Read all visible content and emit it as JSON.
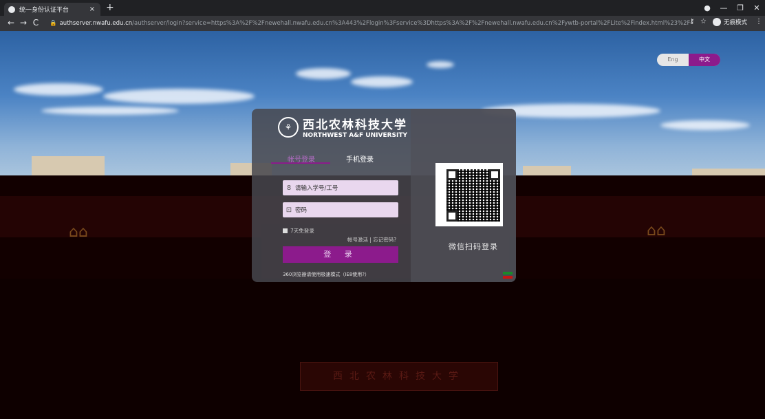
{
  "browser": {
    "tab_title": "统一身份认证平台",
    "tab_close": "×",
    "new_tab": "+",
    "url_host": "authserver.nwafu.edu.cn",
    "url_path": "/authserver/login?service=https%3A%2F%2Fnewehall.nwafu.edu.cn%3A443%2Flogin%3Fservice%3Dhttps%3A%2F%2Fnewehall.nwafu.edu.cn%2Fywtb-portal%2FLite%2Findex.html%23%2F",
    "profile_label": "无痕模式",
    "window_controls": [
      "●",
      "—",
      "❐",
      "✕"
    ]
  },
  "lang_switch": {
    "english": "Eng",
    "chinese": "中文"
  },
  "university": {
    "name_cn": "西北农林科技大学",
    "name_en": "NORTHWEST A&F UNIVERSITY",
    "seal_glyph": "⚘"
  },
  "login": {
    "tab_account": "帐号登录",
    "tab_phone": "手机登录",
    "username_placeholder": "请输入学号/工号",
    "password_placeholder": "密码",
    "remember_label": "7天免登录",
    "links": "帐号激活 | 忘记密码?",
    "login_button": "登 录",
    "browser_hint": "360浏览器请使用极速模式（IE8使用?）"
  },
  "qr": {
    "label": "微信扫码登录"
  },
  "icons": {
    "user": "user-icon",
    "lock": "lock-icon"
  }
}
